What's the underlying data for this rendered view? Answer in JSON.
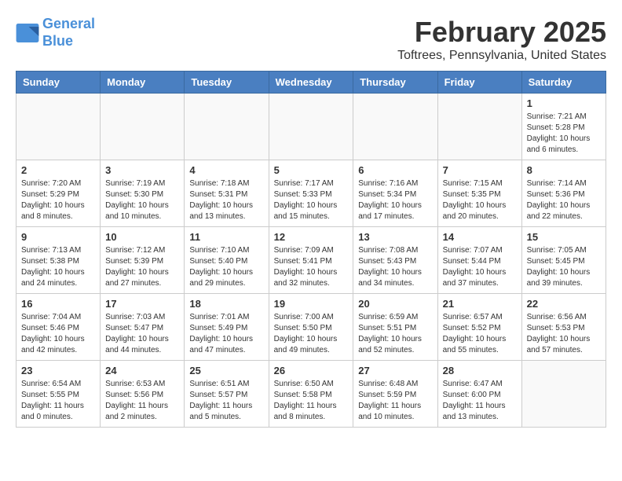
{
  "header": {
    "logo_line1": "General",
    "logo_line2": "Blue",
    "month_title": "February 2025",
    "location": "Toftrees, Pennsylvania, United States"
  },
  "days_of_week": [
    "Sunday",
    "Monday",
    "Tuesday",
    "Wednesday",
    "Thursday",
    "Friday",
    "Saturday"
  ],
  "weeks": [
    [
      {
        "day": "",
        "info": ""
      },
      {
        "day": "",
        "info": ""
      },
      {
        "day": "",
        "info": ""
      },
      {
        "day": "",
        "info": ""
      },
      {
        "day": "",
        "info": ""
      },
      {
        "day": "",
        "info": ""
      },
      {
        "day": "1",
        "info": "Sunrise: 7:21 AM\nSunset: 5:28 PM\nDaylight: 10 hours\nand 6 minutes."
      }
    ],
    [
      {
        "day": "2",
        "info": "Sunrise: 7:20 AM\nSunset: 5:29 PM\nDaylight: 10 hours\nand 8 minutes."
      },
      {
        "day": "3",
        "info": "Sunrise: 7:19 AM\nSunset: 5:30 PM\nDaylight: 10 hours\nand 10 minutes."
      },
      {
        "day": "4",
        "info": "Sunrise: 7:18 AM\nSunset: 5:31 PM\nDaylight: 10 hours\nand 13 minutes."
      },
      {
        "day": "5",
        "info": "Sunrise: 7:17 AM\nSunset: 5:33 PM\nDaylight: 10 hours\nand 15 minutes."
      },
      {
        "day": "6",
        "info": "Sunrise: 7:16 AM\nSunset: 5:34 PM\nDaylight: 10 hours\nand 17 minutes."
      },
      {
        "day": "7",
        "info": "Sunrise: 7:15 AM\nSunset: 5:35 PM\nDaylight: 10 hours\nand 20 minutes."
      },
      {
        "day": "8",
        "info": "Sunrise: 7:14 AM\nSunset: 5:36 PM\nDaylight: 10 hours\nand 22 minutes."
      }
    ],
    [
      {
        "day": "9",
        "info": "Sunrise: 7:13 AM\nSunset: 5:38 PM\nDaylight: 10 hours\nand 24 minutes."
      },
      {
        "day": "10",
        "info": "Sunrise: 7:12 AM\nSunset: 5:39 PM\nDaylight: 10 hours\nand 27 minutes."
      },
      {
        "day": "11",
        "info": "Sunrise: 7:10 AM\nSunset: 5:40 PM\nDaylight: 10 hours\nand 29 minutes."
      },
      {
        "day": "12",
        "info": "Sunrise: 7:09 AM\nSunset: 5:41 PM\nDaylight: 10 hours\nand 32 minutes."
      },
      {
        "day": "13",
        "info": "Sunrise: 7:08 AM\nSunset: 5:43 PM\nDaylight: 10 hours\nand 34 minutes."
      },
      {
        "day": "14",
        "info": "Sunrise: 7:07 AM\nSunset: 5:44 PM\nDaylight: 10 hours\nand 37 minutes."
      },
      {
        "day": "15",
        "info": "Sunrise: 7:05 AM\nSunset: 5:45 PM\nDaylight: 10 hours\nand 39 minutes."
      }
    ],
    [
      {
        "day": "16",
        "info": "Sunrise: 7:04 AM\nSunset: 5:46 PM\nDaylight: 10 hours\nand 42 minutes."
      },
      {
        "day": "17",
        "info": "Sunrise: 7:03 AM\nSunset: 5:47 PM\nDaylight: 10 hours\nand 44 minutes."
      },
      {
        "day": "18",
        "info": "Sunrise: 7:01 AM\nSunset: 5:49 PM\nDaylight: 10 hours\nand 47 minutes."
      },
      {
        "day": "19",
        "info": "Sunrise: 7:00 AM\nSunset: 5:50 PM\nDaylight: 10 hours\nand 49 minutes."
      },
      {
        "day": "20",
        "info": "Sunrise: 6:59 AM\nSunset: 5:51 PM\nDaylight: 10 hours\nand 52 minutes."
      },
      {
        "day": "21",
        "info": "Sunrise: 6:57 AM\nSunset: 5:52 PM\nDaylight: 10 hours\nand 55 minutes."
      },
      {
        "day": "22",
        "info": "Sunrise: 6:56 AM\nSunset: 5:53 PM\nDaylight: 10 hours\nand 57 minutes."
      }
    ],
    [
      {
        "day": "23",
        "info": "Sunrise: 6:54 AM\nSunset: 5:55 PM\nDaylight: 11 hours\nand 0 minutes."
      },
      {
        "day": "24",
        "info": "Sunrise: 6:53 AM\nSunset: 5:56 PM\nDaylight: 11 hours\nand 2 minutes."
      },
      {
        "day": "25",
        "info": "Sunrise: 6:51 AM\nSunset: 5:57 PM\nDaylight: 11 hours\nand 5 minutes."
      },
      {
        "day": "26",
        "info": "Sunrise: 6:50 AM\nSunset: 5:58 PM\nDaylight: 11 hours\nand 8 minutes."
      },
      {
        "day": "27",
        "info": "Sunrise: 6:48 AM\nSunset: 5:59 PM\nDaylight: 11 hours\nand 10 minutes."
      },
      {
        "day": "28",
        "info": "Sunrise: 6:47 AM\nSunset: 6:00 PM\nDaylight: 11 hours\nand 13 minutes."
      },
      {
        "day": "",
        "info": ""
      }
    ]
  ]
}
